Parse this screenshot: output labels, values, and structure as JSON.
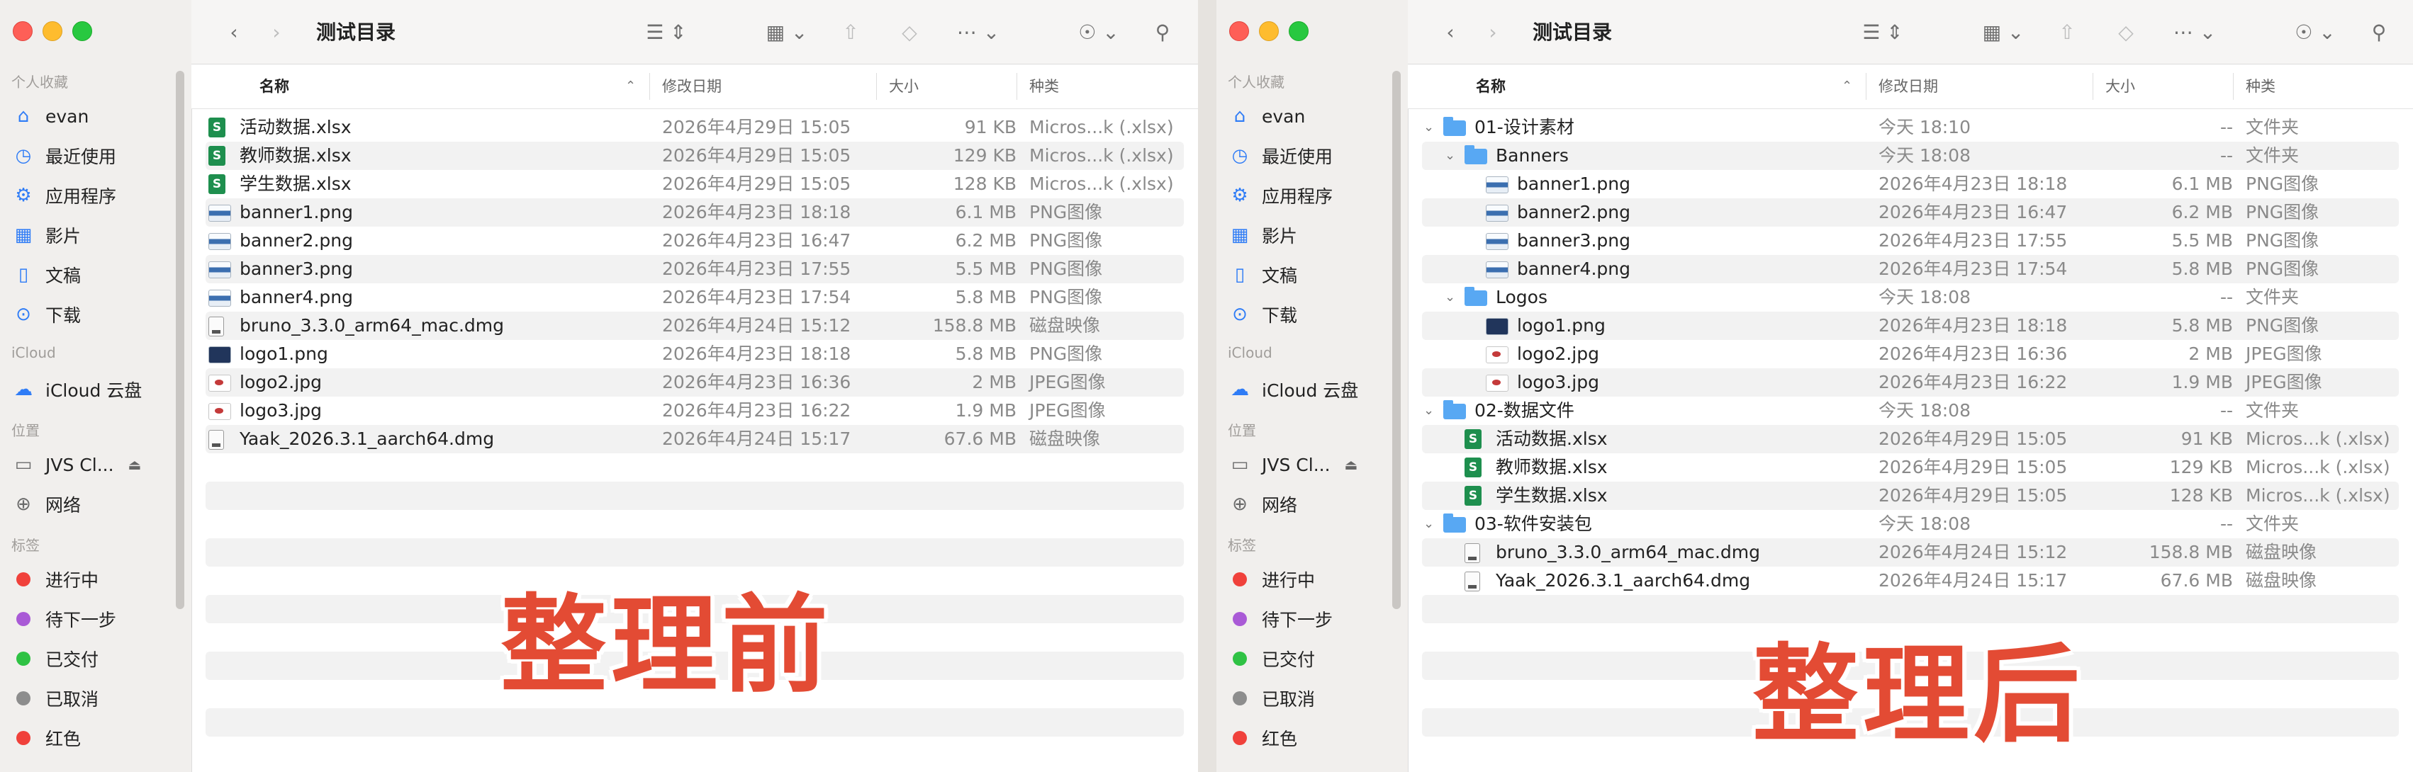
{
  "sidebar": {
    "favorites_label": "个人收藏",
    "favorites": [
      {
        "icon": "house-icon",
        "label": "evan"
      },
      {
        "icon": "clock-icon",
        "label": "最近使用"
      },
      {
        "icon": "apps-icon",
        "label": "应用程序"
      },
      {
        "icon": "film-icon",
        "label": "影片"
      },
      {
        "icon": "document-icon",
        "label": "文稿"
      },
      {
        "icon": "download-icon",
        "label": "下载"
      }
    ],
    "icloud_label": "iCloud",
    "icloud_items": [
      {
        "icon": "cloud-icon",
        "label": "iCloud 云盘"
      }
    ],
    "locations_label": "位置",
    "locations": [
      {
        "icon": "drive-icon",
        "label": "JVS Cl...",
        "eject": "⏏"
      },
      {
        "icon": "globe-icon",
        "label": "网络"
      }
    ],
    "tags_label": "标签",
    "tags": [
      {
        "label": "进行中",
        "color": "#f0413b"
      },
      {
        "label": "待下一步",
        "color": "#a95ad6"
      },
      {
        "label": "已交付",
        "color": "#2fc244"
      },
      {
        "label": "已取消",
        "color": "#8d8d8d"
      },
      {
        "label": "红色",
        "color": "#f0413b"
      }
    ]
  },
  "toolbar": {
    "title": "测试目录"
  },
  "columns": {
    "name": "名称",
    "date": "修改日期",
    "size": "大小",
    "kind": "种类"
  },
  "left_files": [
    {
      "icon": "xlsx",
      "name": "活动数据.xlsx",
      "date": "2026年4月29日 15:05",
      "size": "91 KB",
      "kind": "Micros...k (.xlsx)"
    },
    {
      "icon": "xlsx",
      "name": "教师数据.xlsx",
      "date": "2026年4月29日 15:05",
      "size": "129 KB",
      "kind": "Micros...k (.xlsx)"
    },
    {
      "icon": "xlsx",
      "name": "学生数据.xlsx",
      "date": "2026年4月29日 15:05",
      "size": "128 KB",
      "kind": "Micros...k (.xlsx)"
    },
    {
      "icon": "png",
      "name": "banner1.png",
      "date": "2026年4月23日 18:18",
      "size": "6.1 MB",
      "kind": "PNG图像"
    },
    {
      "icon": "png",
      "name": "banner2.png",
      "date": "2026年4月23日 16:47",
      "size": "6.2 MB",
      "kind": "PNG图像"
    },
    {
      "icon": "png",
      "name": "banner3.png",
      "date": "2026年4月23日 17:55",
      "size": "5.5 MB",
      "kind": "PNG图像"
    },
    {
      "icon": "png",
      "name": "banner4.png",
      "date": "2026年4月23日 17:54",
      "size": "5.8 MB",
      "kind": "PNG图像"
    },
    {
      "icon": "dmg",
      "name": "bruno_3.3.0_arm64_mac.dmg",
      "date": "2026年4月24日 15:12",
      "size": "158.8 MB",
      "kind": "磁盘映像"
    },
    {
      "icon": "logo",
      "name": "logo1.png",
      "date": "2026年4月23日 18:18",
      "size": "5.8 MB",
      "kind": "PNG图像"
    },
    {
      "icon": "jpg",
      "name": "logo2.jpg",
      "date": "2026年4月23日 16:36",
      "size": "2 MB",
      "kind": "JPEG图像"
    },
    {
      "icon": "jpg",
      "name": "logo3.jpg",
      "date": "2026年4月23日 16:22",
      "size": "1.9 MB",
      "kind": "JPEG图像"
    },
    {
      "icon": "dmg",
      "name": "Yaak_2026.3.1_aarch64.dmg",
      "date": "2026年4月24日 15:17",
      "size": "67.6 MB",
      "kind": "磁盘映像"
    }
  ],
  "right_files": [
    {
      "level": 0,
      "disc": "⌄",
      "icon": "folder",
      "name": "01-设计素材",
      "date": "今天 18:10",
      "size": "--",
      "kind": "文件夹"
    },
    {
      "level": 1,
      "disc": "⌄",
      "icon": "folder",
      "name": "Banners",
      "date": "今天 18:08",
      "size": "--",
      "kind": "文件夹"
    },
    {
      "level": 2,
      "disc": "",
      "icon": "png",
      "name": "banner1.png",
      "date": "2026年4月23日 18:18",
      "size": "6.1 MB",
      "kind": "PNG图像"
    },
    {
      "level": 2,
      "disc": "",
      "icon": "png",
      "name": "banner2.png",
      "date": "2026年4月23日 16:47",
      "size": "6.2 MB",
      "kind": "PNG图像"
    },
    {
      "level": 2,
      "disc": "",
      "icon": "png",
      "name": "banner3.png",
      "date": "2026年4月23日 17:55",
      "size": "5.5 MB",
      "kind": "PNG图像"
    },
    {
      "level": 2,
      "disc": "",
      "icon": "png",
      "name": "banner4.png",
      "date": "2026年4月23日 17:54",
      "size": "5.8 MB",
      "kind": "PNG图像"
    },
    {
      "level": 1,
      "disc": "⌄",
      "icon": "folder",
      "name": "Logos",
      "date": "今天 18:08",
      "size": "--",
      "kind": "文件夹"
    },
    {
      "level": 2,
      "disc": "",
      "icon": "logo",
      "name": "logo1.png",
      "date": "2026年4月23日 18:18",
      "size": "5.8 MB",
      "kind": "PNG图像"
    },
    {
      "level": 2,
      "disc": "",
      "icon": "jpg",
      "name": "logo2.jpg",
      "date": "2026年4月23日 16:36",
      "size": "2 MB",
      "kind": "JPEG图像"
    },
    {
      "level": 2,
      "disc": "",
      "icon": "jpg",
      "name": "logo3.jpg",
      "date": "2026年4月23日 16:22",
      "size": "1.9 MB",
      "kind": "JPEG图像"
    },
    {
      "level": 0,
      "disc": "⌄",
      "icon": "folder",
      "name": "02-数据文件",
      "date": "今天 18:08",
      "size": "--",
      "kind": "文件夹"
    },
    {
      "level": 1,
      "disc": "",
      "icon": "xlsx",
      "name": "活动数据.xlsx",
      "date": "2026年4月29日 15:05",
      "size": "91 KB",
      "kind": "Micros...k (.xlsx)"
    },
    {
      "level": 1,
      "disc": "",
      "icon": "xlsx",
      "name": "教师数据.xlsx",
      "date": "2026年4月29日 15:05",
      "size": "129 KB",
      "kind": "Micros...k (.xlsx)"
    },
    {
      "level": 1,
      "disc": "",
      "icon": "xlsx",
      "name": "学生数据.xlsx",
      "date": "2026年4月29日 15:05",
      "size": "128 KB",
      "kind": "Micros...k (.xlsx)"
    },
    {
      "level": 0,
      "disc": "⌄",
      "icon": "folder",
      "name": "03-软件安装包",
      "date": "今天 18:08",
      "size": "--",
      "kind": "文件夹"
    },
    {
      "level": 1,
      "disc": "",
      "icon": "dmg",
      "name": "bruno_3.3.0_arm64_mac.dmg",
      "date": "2026年4月24日 15:12",
      "size": "158.8 MB",
      "kind": "磁盘映像"
    },
    {
      "level": 1,
      "disc": "",
      "icon": "dmg",
      "name": "Yaak_2026.3.1_aarch64.dmg",
      "date": "2026年4月24日 15:17",
      "size": "67.6 MB",
      "kind": "磁盘映像"
    }
  ],
  "overlay": {
    "before": "整理前",
    "after": "整理后"
  },
  "xlsx_glyph": "S"
}
